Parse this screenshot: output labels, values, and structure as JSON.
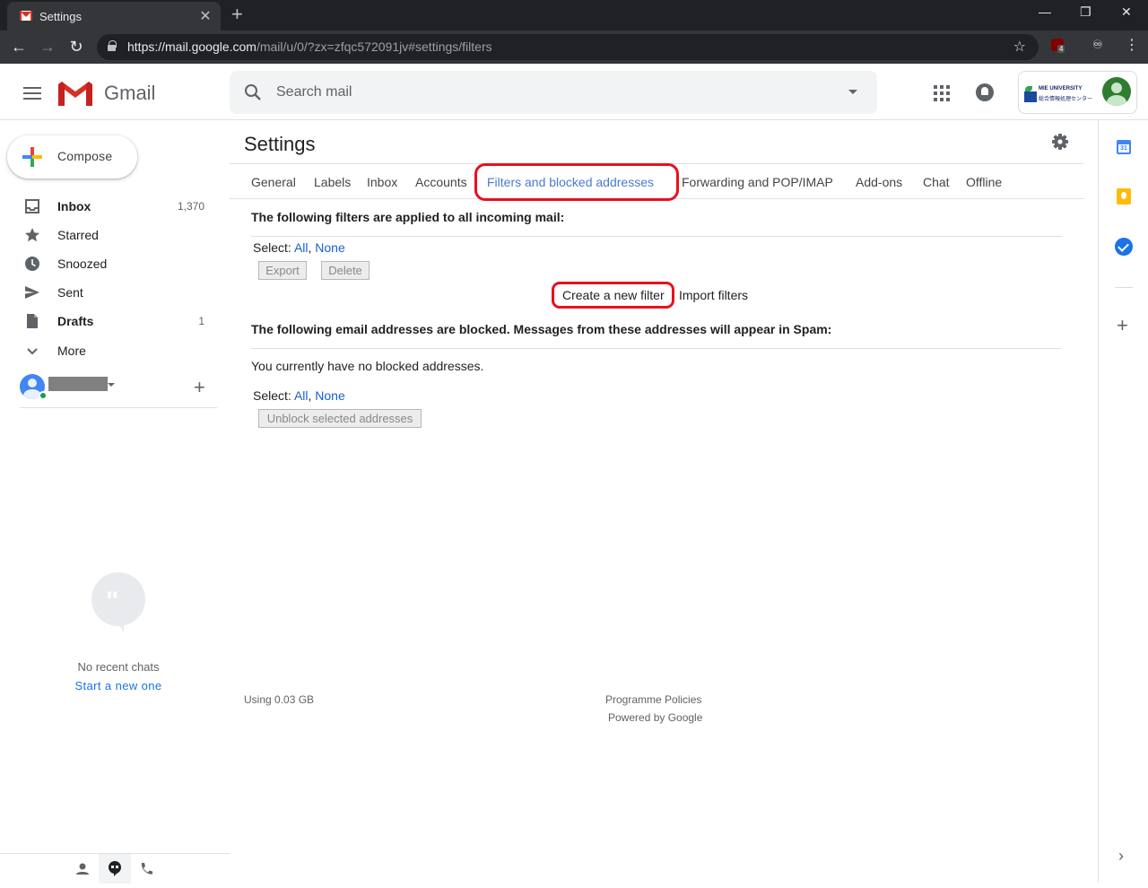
{
  "browser": {
    "tab_title": "Settings",
    "tab_close": "✕",
    "new_tab": "+",
    "url_host": "https://mail.google.com",
    "url_path": "/mail/u/0/?zx=zfqc572091jv#settings/filters",
    "ext_badge": "4"
  },
  "header": {
    "brand": "Gmail",
    "search_placeholder": "Search mail"
  },
  "account": {
    "org_line1": "MIE UNIVERSITY",
    "org_line2": "総合情報処理センター"
  },
  "sidebar": {
    "compose": "Compose",
    "items": [
      {
        "label": "Inbox",
        "count": "1,370"
      },
      {
        "label": "Starred",
        "count": ""
      },
      {
        "label": "Snoozed",
        "count": ""
      },
      {
        "label": "Sent",
        "count": ""
      },
      {
        "label": "Drafts",
        "count": "1"
      },
      {
        "label": "More",
        "count": ""
      }
    ],
    "no_chats": "No recent chats",
    "start_chat": "Start a new one"
  },
  "settings": {
    "title": "Settings",
    "tabs": [
      "General",
      "Labels",
      "Inbox",
      "Accounts",
      "Filters and blocked addresses",
      "Forwarding and POP/IMAP",
      "Add-ons",
      "Chat",
      "Offline"
    ],
    "filters_heading": "The following filters are applied to all incoming mail:",
    "select_label": "Select:",
    "select_all": "All",
    "select_none": "None",
    "export_btn": "Export",
    "delete_btn": "Delete",
    "create_filter": "Create a new filter",
    "import_filters": "Import filters",
    "blocked_heading": "The following email addresses are blocked. Messages from these addresses will appear in Spam:",
    "no_blocked": "You currently have no blocked addresses.",
    "unblock_btn": "Unblock selected addresses"
  },
  "footer": {
    "usage": "Using 0.03 GB",
    "policies": "Programme Policies",
    "powered": "Powered by Google"
  },
  "right_panel": {
    "calendar_day": "31"
  },
  "colors": {
    "highlight": "#e8101e",
    "link": "#1a5fce",
    "active_tab": "#4a7bd0"
  }
}
